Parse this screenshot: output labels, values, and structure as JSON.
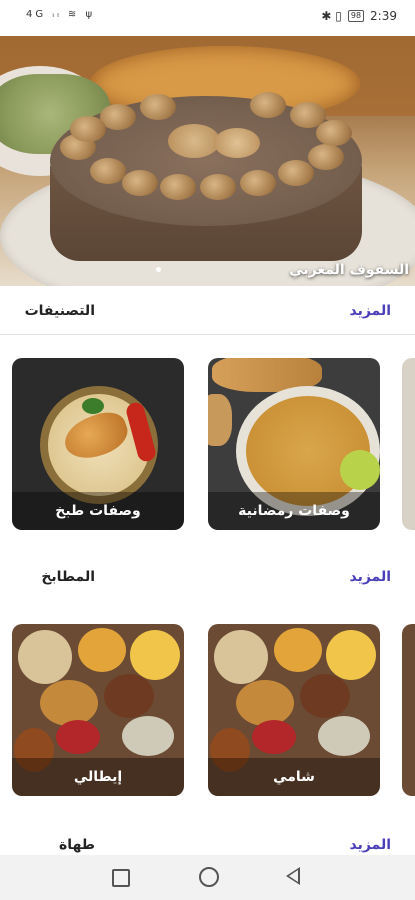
{
  "status_bar": {
    "left_indicators": "4G ᵢₗ ≋ ψ",
    "right_icons": "✱ ▯",
    "battery": "98",
    "time": "2:39"
  },
  "hero": {
    "title": "السفوف المغربي",
    "slide_count": 1,
    "active_slide": 1
  },
  "sections": [
    {
      "title": "التصنيفات",
      "more_label": "المزيد",
      "cards": [
        {
          "label": "وصفات رمضانية",
          "image": "ramadan-dishes"
        },
        {
          "label": "وصفات طبخ",
          "image": "chicken-rice"
        }
      ]
    },
    {
      "title": "المطابخ",
      "more_label": "المزيد",
      "cards": [
        {
          "label": "شامي",
          "image": "spices"
        },
        {
          "label": "إيطالي",
          "image": "spices"
        }
      ]
    },
    {
      "title": "طهاة",
      "more_label": "المزيد"
    }
  ],
  "nav_bar": {
    "icons": [
      "square-recents-icon",
      "circle-home-icon",
      "triangle-back-icon"
    ]
  }
}
